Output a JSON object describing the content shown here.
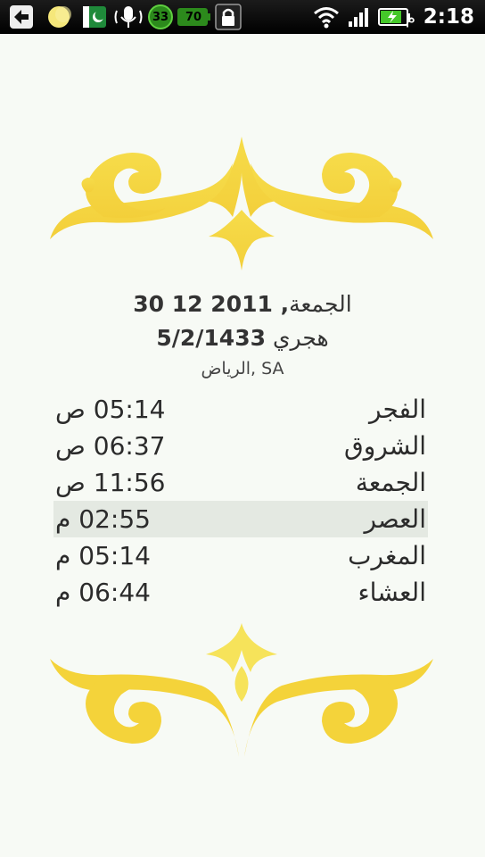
{
  "status_bar": {
    "time": "2:18",
    "ampm": "م",
    "battery_percent": "70",
    "temperature": "33"
  },
  "header": {
    "date_day": "الجمعة",
    "date_numbers": "2011 12 30",
    "hijri_date": "5/2/1433",
    "hijri_label": "هجري",
    "location": "الرياض, SA"
  },
  "prayers": [
    {
      "name": "الفجر",
      "time": "05:14 ص"
    },
    {
      "name": "الشروق",
      "time": "06:37 ص"
    },
    {
      "name": "الجمعة",
      "time": "11:56 ص"
    },
    {
      "name": "العصر",
      "time": "02:55 م"
    },
    {
      "name": "المغرب",
      "time": "05:14 م"
    },
    {
      "name": "العشاء",
      "time": "06:44 م"
    }
  ],
  "colors": {
    "ornament": "#f4d33a",
    "active_row": "#e4e9e2",
    "background": "#f7faf5"
  }
}
